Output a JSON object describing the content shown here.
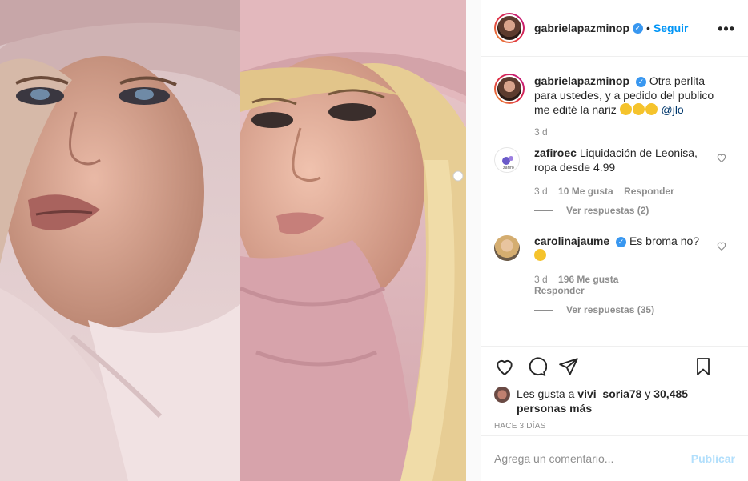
{
  "post": {
    "author": {
      "username": "gabrielapazminop",
      "verified": true
    },
    "follow_label": "Seguir",
    "separator": "•",
    "more_label": "•••"
  },
  "caption": {
    "username": "gabrielapazminop",
    "text": "Otra perlita para ustedes, y a pedido del publico me edité la nariz",
    "emojis": [
      "grinning",
      "laughing",
      "rofl"
    ],
    "mention": "@jlo",
    "time": "3 d"
  },
  "comments": [
    {
      "username": "zafiroec",
      "text": "Liquidación de Leonisa, ropa desde 4.99",
      "time": "3 d",
      "likes": "10 Me gusta",
      "reply_label": "Responder",
      "view_replies": "Ver respuestas (2)"
    },
    {
      "username": "carolinajaume",
      "verified": true,
      "text": "Es broma no?",
      "emoji": "zany",
      "time": "3 d",
      "likes": "196 Me gusta",
      "reply_label": "Responder",
      "view_replies": "Ver respuestas (35)"
    }
  ],
  "likes_summary": {
    "prefix": "Les gusta a",
    "user": "vivi_soria78",
    "conjunction": "y",
    "count": "30,485 personas más"
  },
  "time_ago": "HACE 3 DÍAS",
  "add_comment": {
    "placeholder": "Agrega un comentario...",
    "publish_label": "Publicar"
  },
  "icons": [
    "heart-icon",
    "comment-icon",
    "share-icon",
    "bookmark-icon",
    "more-icon",
    "verified-icon"
  ],
  "colors": {
    "link_blue": "#0095f6",
    "publish_disabled": "#b2dffc",
    "verified": "#3897f0",
    "muted": "#8e8e8e"
  }
}
